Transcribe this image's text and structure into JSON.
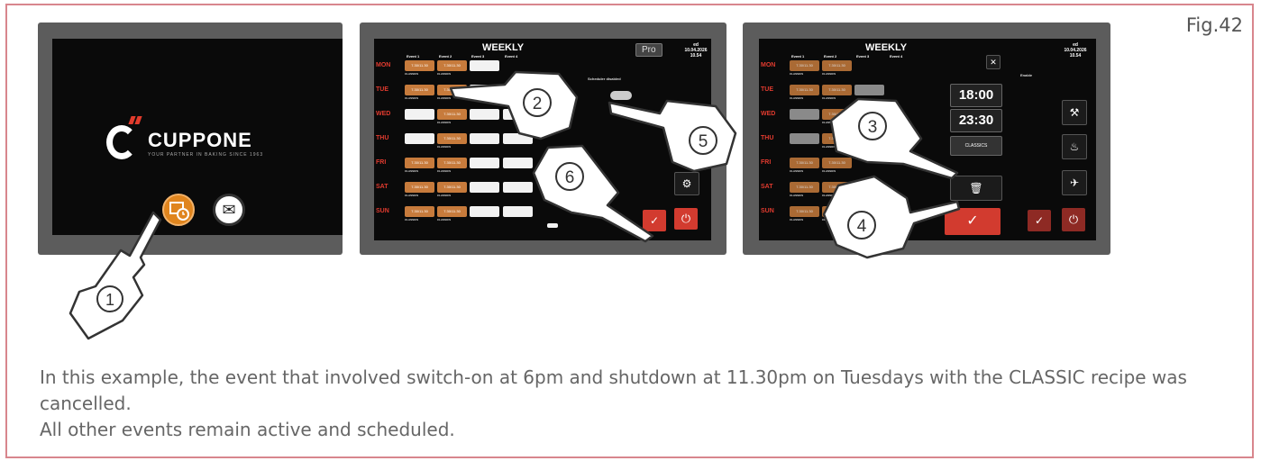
{
  "figure_label": "Fig.42",
  "screen1": {
    "brand": "CUPPONE",
    "tagline": "YOUR PARTNER IN BAKING SINCE 1963"
  },
  "screen2": {
    "title": "WEEKLY",
    "pro_label": "Pro",
    "side_day": "ed",
    "side_date": "10.04.2026",
    "side_time": "10.54",
    "scheduler_label": "Scheduler disabled",
    "event_headers": [
      "Event 1",
      "Event 2",
      "Event 3",
      "Event 4"
    ],
    "days": [
      "MON",
      "TUE",
      "WED",
      "THU",
      "FRI",
      "SAT",
      "SUN"
    ],
    "cell_text": "7.30/11.30",
    "recipe_text": "CLASSICS"
  },
  "screen3": {
    "title": "WEEKLY",
    "side_day": "ed",
    "side_date": "10.04.2026",
    "side_time": "10.54",
    "time_on": "18:00",
    "time_off": "23:30",
    "recipe_label": "CLASSICS",
    "enable_label": "Enable"
  },
  "step_numbers": [
    "1",
    "2",
    "3",
    "4",
    "5",
    "6"
  ],
  "caption": {
    "line1": "In this example, the event that involved switch-on at 6pm and shutdown at 11.30pm on Tuesdays with the CLASSIC recipe was cancelled.",
    "line2": "All other events remain active and scheduled."
  },
  "colors": {
    "border": "#d8868d",
    "accent_red": "#d23b2f",
    "accent_orange": "#c77b3c"
  }
}
